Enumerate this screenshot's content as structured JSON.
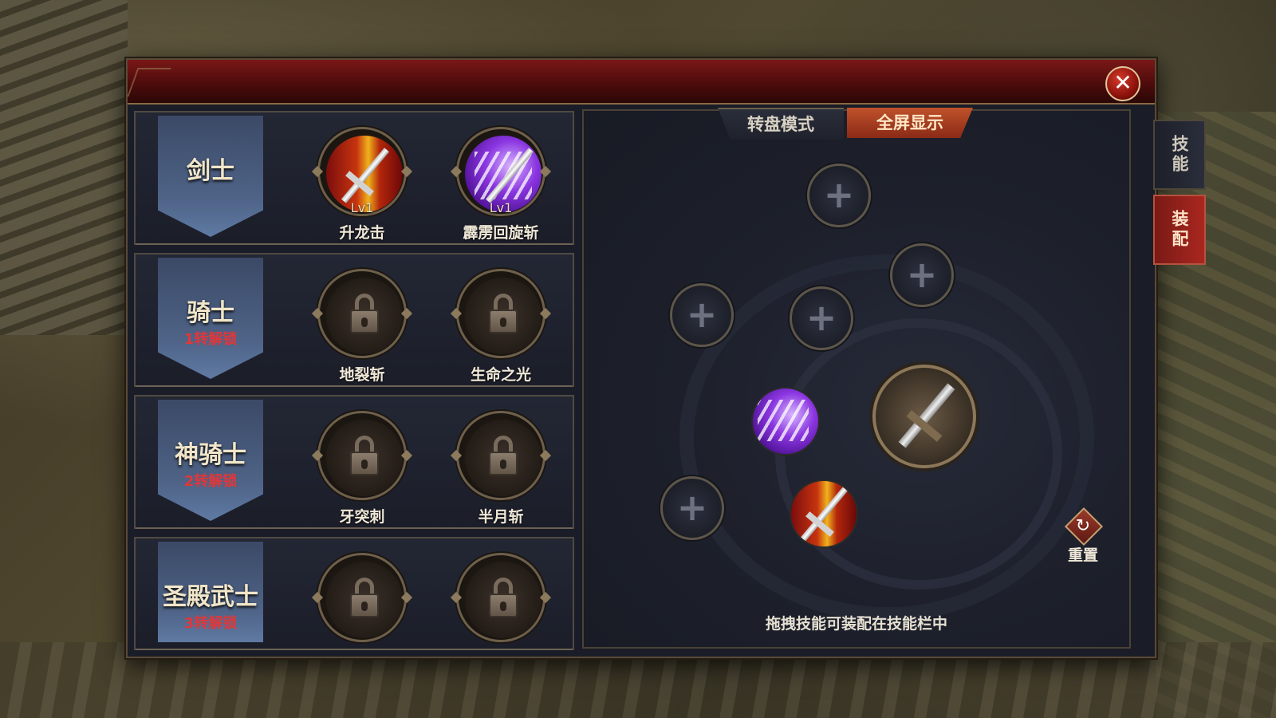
{
  "window": {
    "close_icon": "✕"
  },
  "classes": [
    {
      "name": "剑士",
      "unlock": "",
      "skills": [
        {
          "name": "升龙击",
          "level": "Lv1",
          "icon": "red-sword-icon"
        },
        {
          "name": "霹雳回旋斩",
          "level": "Lv1",
          "icon": "purple-sword-icon"
        }
      ]
    },
    {
      "name": "骑士",
      "unlock": "1转解锁",
      "skills": [
        {
          "name": "地裂斩",
          "level": "",
          "icon": "lock-icon"
        },
        {
          "name": "生命之光",
          "level": "",
          "icon": "lock-icon"
        }
      ]
    },
    {
      "name": "神骑士",
      "unlock": "2转解锁",
      "skills": [
        {
          "name": "牙突刺",
          "level": "",
          "icon": "lock-icon"
        },
        {
          "name": "半月斩",
          "level": "",
          "icon": "lock-icon"
        }
      ]
    },
    {
      "name": "圣殿武士",
      "unlock": "3转解锁",
      "skills": [
        {
          "name": "",
          "level": "",
          "icon": "lock-icon"
        },
        {
          "name": "",
          "level": "",
          "icon": "lock-icon"
        }
      ]
    }
  ],
  "equip": {
    "tabs": {
      "wheel": "转盘模式",
      "fullscreen": "全屏显示"
    },
    "plus": "+",
    "reset": {
      "icon": "↻",
      "label": "重置"
    },
    "hint": "拖拽技能可装配在技能栏中"
  },
  "side_tabs": {
    "skill": "技能",
    "equip": "装配"
  },
  "colors": {
    "accent_red": "#a9271f",
    "locked_text": "#e0373a",
    "text": "#f0e8d8"
  }
}
